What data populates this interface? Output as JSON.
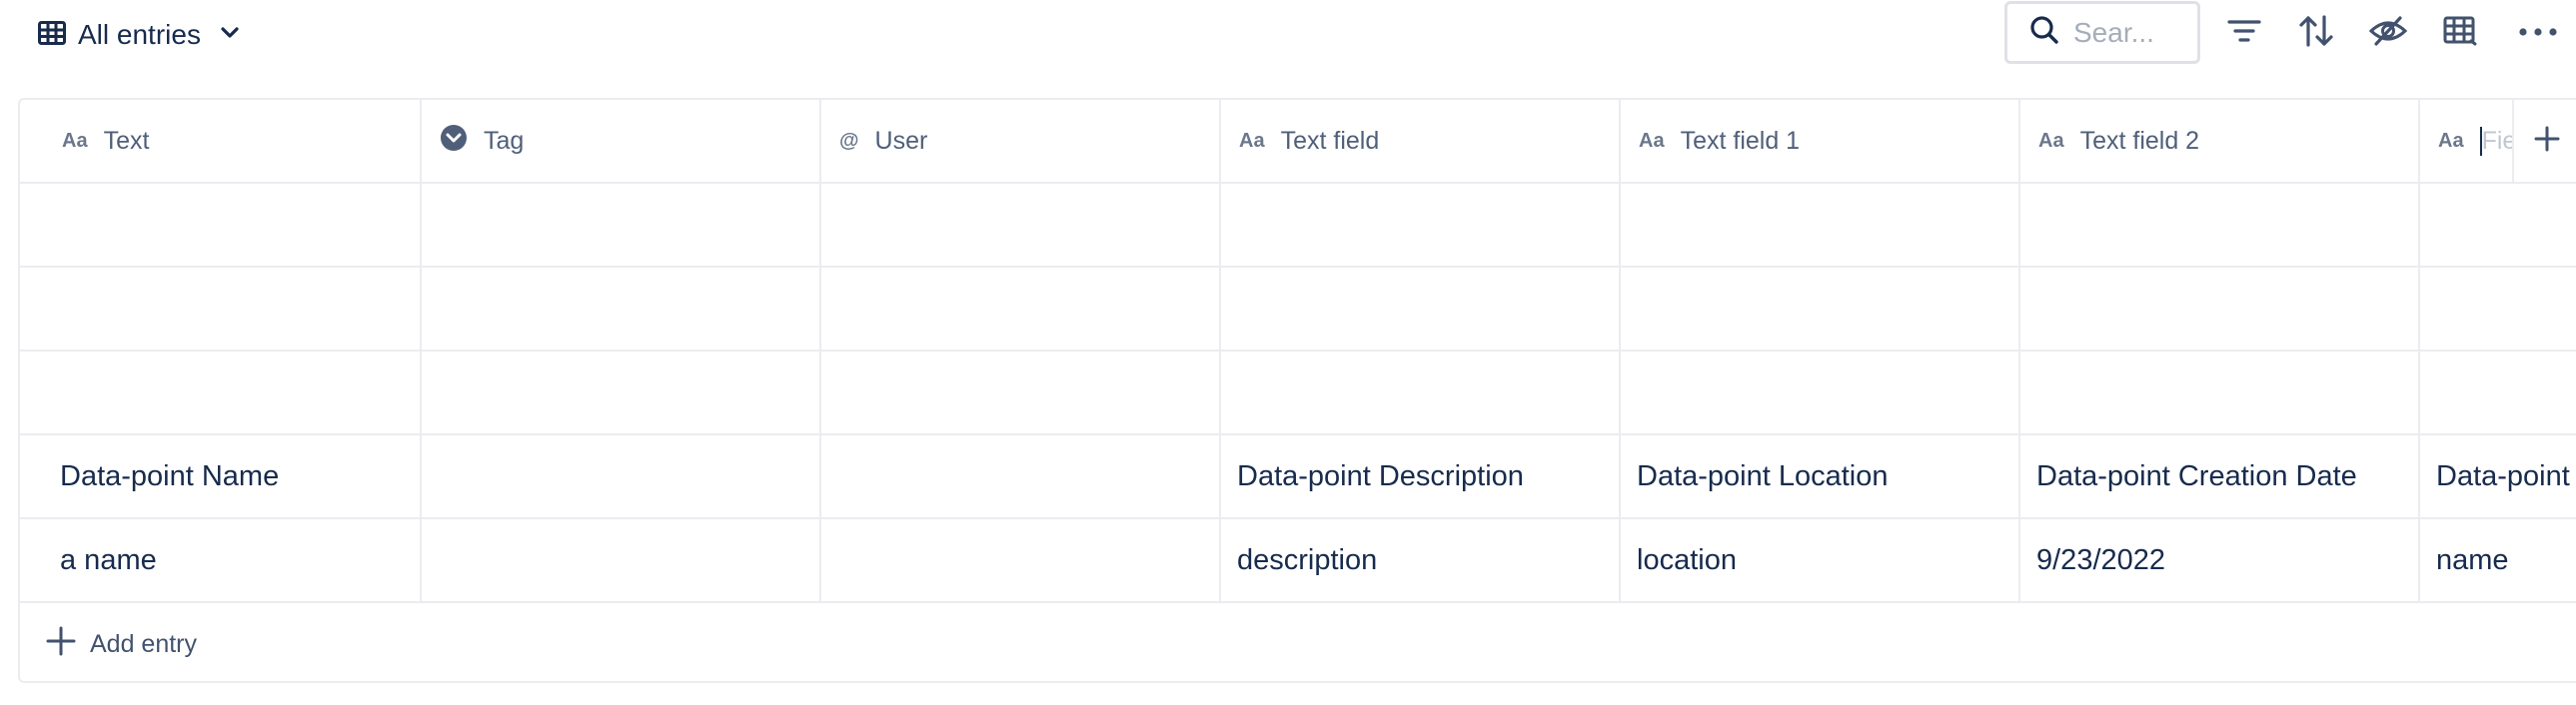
{
  "toolbar": {
    "view_label": "All entries",
    "search_placeholder": "Sear...",
    "icons": [
      "table-icon",
      "chevron-down-icon",
      "search-icon",
      "filter-icon",
      "sort-icon",
      "hide-fields-icon",
      "table-settings-icon",
      "more-icon"
    ]
  },
  "table": {
    "columns": [
      {
        "type_icon": "Aa",
        "label": "Text"
      },
      {
        "type_icon": "tag",
        "label": "Tag"
      },
      {
        "type_icon": "@",
        "label": "User"
      },
      {
        "type_icon": "Aa",
        "label": "Text field"
      },
      {
        "type_icon": "Aa",
        "label": "Text field 1"
      },
      {
        "type_icon": "Aa",
        "label": "Text field 2"
      },
      {
        "type_icon": "Aa",
        "label": ""
      }
    ],
    "new_field_placeholder": "Field",
    "rows": [
      [
        "",
        "",
        "",
        "",
        "",
        "",
        ""
      ],
      [
        "",
        "",
        "",
        "",
        "",
        "",
        ""
      ],
      [
        "",
        "",
        "",
        "",
        "",
        "",
        ""
      ],
      [
        "Data-point Name",
        "",
        "",
        "Data-point Description",
        "Data-point Location",
        "Data-point Creation Date",
        "Data-point"
      ],
      [
        "a name",
        "",
        "",
        "description",
        "location",
        "9/23/2022",
        "name"
      ]
    ],
    "add_entry_label": "Add entry"
  }
}
